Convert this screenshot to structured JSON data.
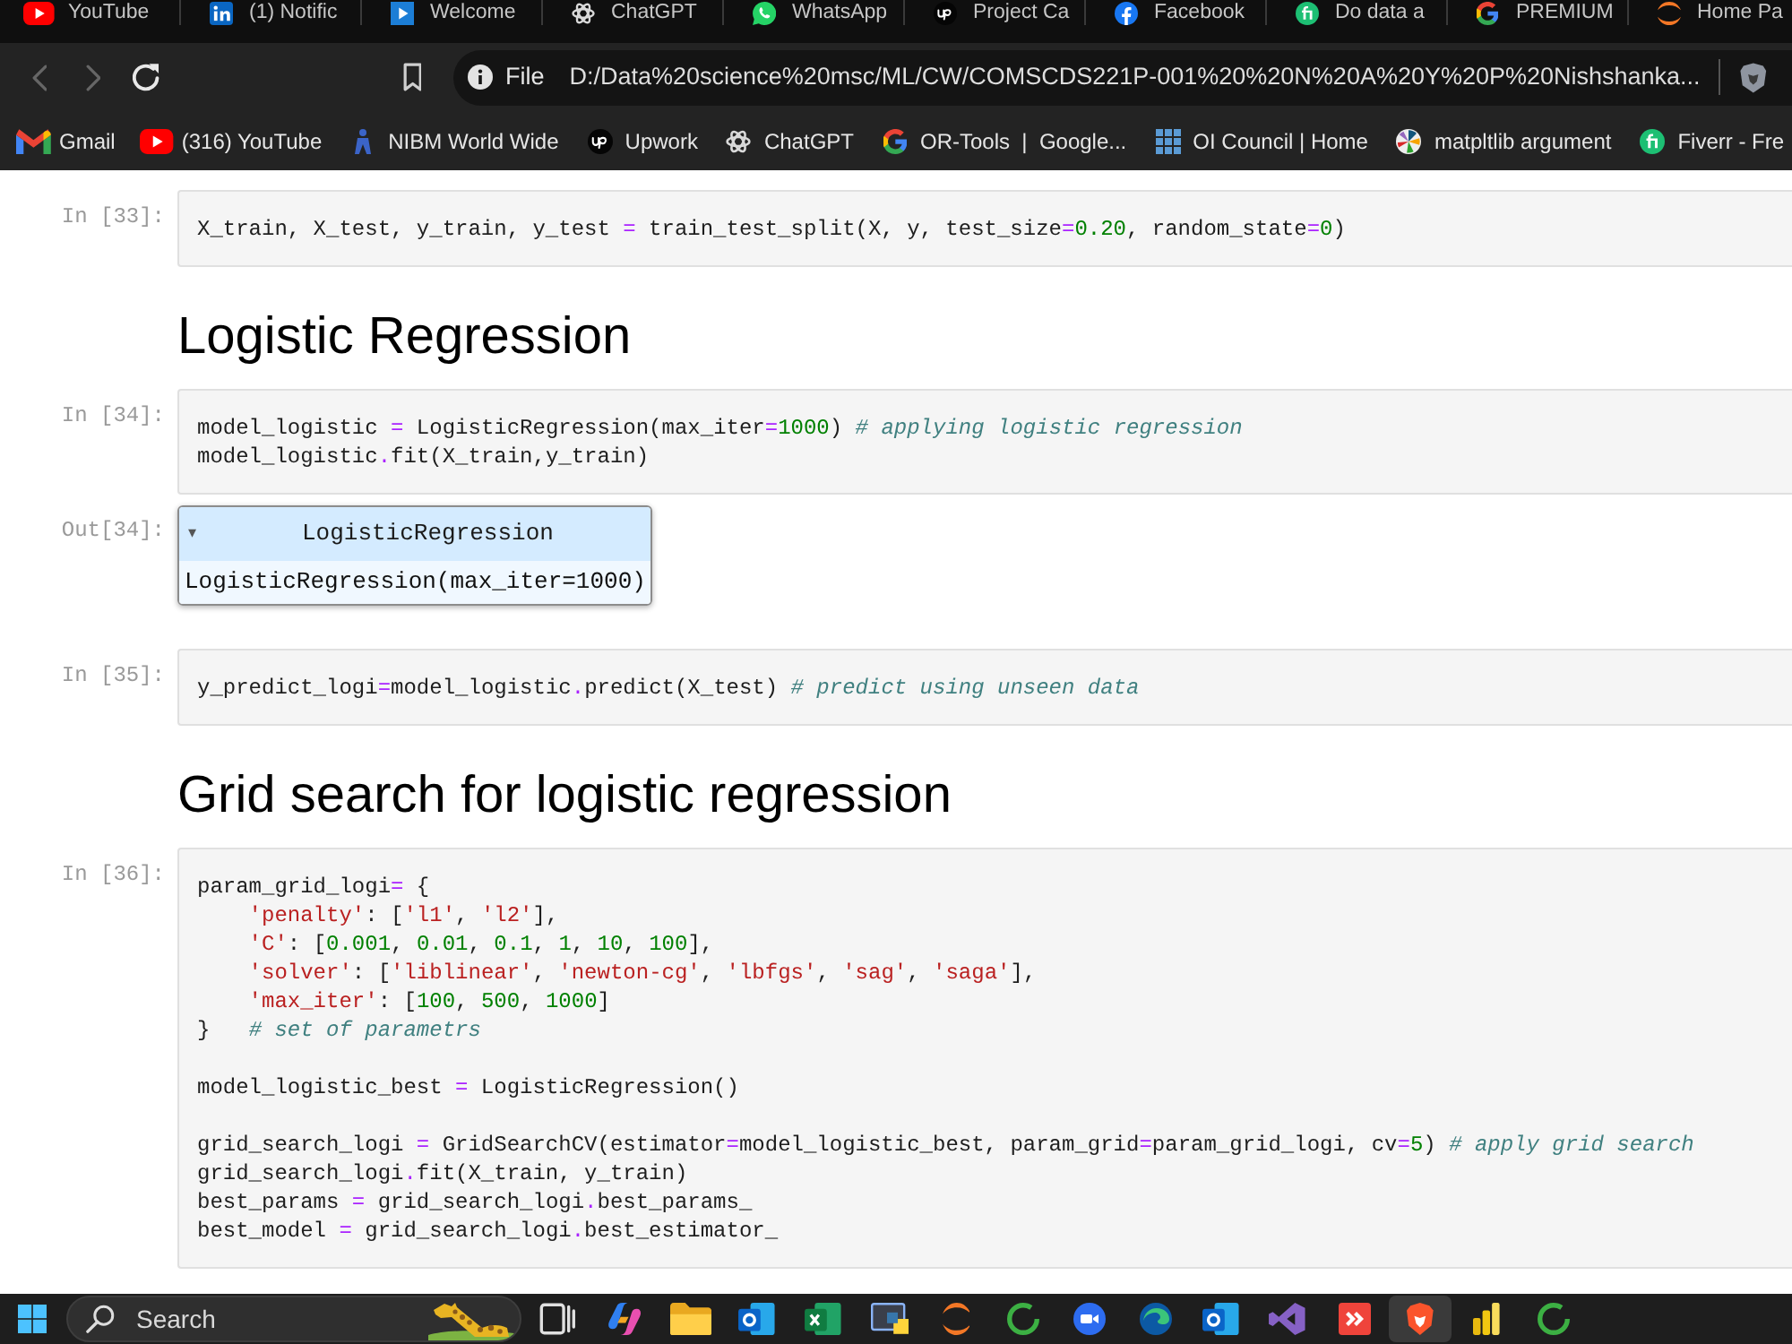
{
  "browser": {
    "tabs": [
      {
        "kind": "play",
        "title": "YouTube"
      },
      {
        "kind": "tile",
        "title": "(1) Notific"
      },
      {
        "kind": "flag",
        "title": "Welcome"
      },
      {
        "kind": "knot",
        "title": "ChatGPT"
      },
      {
        "kind": "chat",
        "title": "WhatsApp"
      },
      {
        "kind": "up",
        "title": "Project Ca"
      },
      {
        "kind": "f",
        "title": "Facebook"
      },
      {
        "kind": "fi",
        "title": "Do data a"
      },
      {
        "kind": "g",
        "title": "PREMIUM"
      },
      {
        "kind": "arc",
        "title": "Home Pa"
      }
    ],
    "toolbar": {
      "back": {
        "disabled": true
      },
      "forward": {
        "disabled": true
      },
      "site_chip": "File",
      "url": "D:/Data%20science%20msc/ML/CW/COMSCDS221P-001%20%20N%20A%20Y%20P%20Nishshanka..."
    },
    "bookmarks": [
      {
        "kind": "mail",
        "label": "Gmail"
      },
      {
        "kind": "play",
        "label": "(316) YouTube"
      },
      {
        "kind": "n",
        "label": "NIBM World Wide"
      },
      {
        "kind": "up",
        "label": "Upwork"
      },
      {
        "kind": "knot",
        "label": "ChatGPT"
      },
      {
        "kind": "g",
        "label": "OR-Tools  |  Google..."
      },
      {
        "kind": "grid",
        "label": "OI Council | Home"
      },
      {
        "kind": "pinwheel",
        "label": "matpltlib argument"
      },
      {
        "kind": "fi",
        "label": "Fiverr - Fre"
      }
    ]
  },
  "notebook": {
    "cells": [
      {
        "kind": "code",
        "prompt": "In [33]:",
        "blocks": [
          [
            [
              {
                "kind": "text",
                "text": "X_train, X_test, y_train, y_test "
              },
              {
                "kind": "op",
                "text": "="
              },
              {
                "kind": "text",
                "text": " train_test_split(X, y, test_size"
              },
              {
                "kind": "op",
                "text": "="
              },
              {
                "kind": "num",
                "text": "0.20"
              },
              {
                "kind": "text",
                "text": ", random_state"
              },
              {
                "kind": "op",
                "text": "="
              },
              {
                "kind": "num",
                "text": "0"
              },
              {
                "kind": "text",
                "text": ")"
              }
            ]
          ]
        ]
      },
      {
        "kind": "heading",
        "text": "Logistic Regression"
      },
      {
        "kind": "code",
        "prompt": "In [34]:",
        "blocks": [
          [
            [
              {
                "kind": "text",
                "text": "model_logistic "
              },
              {
                "kind": "op",
                "text": "="
              },
              {
                "kind": "text",
                "text": " LogisticRegression(max_iter"
              },
              {
                "kind": "op",
                "text": "="
              },
              {
                "kind": "num",
                "text": "1000"
              },
              {
                "kind": "text",
                "text": ") "
              },
              {
                "kind": "comment",
                "text": "# applying logistic regression"
              }
            ],
            [
              {
                "kind": "text",
                "text": "model_logistic"
              },
              {
                "kind": "op",
                "text": "."
              },
              {
                "kind": "text",
                "text": "fit(X_train,y_train)"
              }
            ]
          ]
        ]
      },
      {
        "kind": "output",
        "prompt": "Out[34]:",
        "toggle": "▾",
        "header": "LogisticRegression",
        "body": "LogisticRegression(max_iter=1000)"
      },
      {
        "kind": "code",
        "prompt": "In [35]:",
        "blocks": [
          [
            [
              {
                "kind": "text",
                "text": "y_predict_logi"
              },
              {
                "kind": "op",
                "text": "="
              },
              {
                "kind": "text",
                "text": "model_logistic"
              },
              {
                "kind": "op",
                "text": "."
              },
              {
                "kind": "text",
                "text": "predict(X_test) "
              },
              {
                "kind": "comment",
                "text": "# predict using unseen data"
              }
            ]
          ]
        ]
      },
      {
        "kind": "heading",
        "text": "Grid search for logistic regression"
      },
      {
        "kind": "code",
        "prompt": "In [36]:",
        "blocks": [
          [
            [
              {
                "kind": "text",
                "text": "param_grid_logi"
              },
              {
                "kind": "op",
                "text": "="
              },
              {
                "kind": "text",
                "text": " {"
              }
            ],
            [
              {
                "kind": "str",
                "text": "    'penalty'"
              },
              {
                "kind": "text",
                "text": ": ["
              },
              {
                "kind": "str",
                "text": "'l1'"
              },
              {
                "kind": "text",
                "text": ", "
              },
              {
                "kind": "str",
                "text": "'l2'"
              },
              {
                "kind": "text",
                "text": "],"
              }
            ],
            [
              {
                "kind": "str",
                "text": "    'C'"
              },
              {
                "kind": "text",
                "text": ": ["
              },
              {
                "kind": "num",
                "text": "0.001"
              },
              {
                "kind": "text",
                "text": ", "
              },
              {
                "kind": "num",
                "text": "0.01"
              },
              {
                "kind": "text",
                "text": ", "
              },
              {
                "kind": "num",
                "text": "0.1"
              },
              {
                "kind": "text",
                "text": ", "
              },
              {
                "kind": "num",
                "text": "1"
              },
              {
                "kind": "text",
                "text": ", "
              },
              {
                "kind": "num",
                "text": "10"
              },
              {
                "kind": "text",
                "text": ", "
              },
              {
                "kind": "num",
                "text": "100"
              },
              {
                "kind": "text",
                "text": "],"
              }
            ],
            [
              {
                "kind": "str",
                "text": "    'solver'"
              },
              {
                "kind": "text",
                "text": ": ["
              },
              {
                "kind": "str",
                "text": "'liblinear'"
              },
              {
                "kind": "text",
                "text": ", "
              },
              {
                "kind": "str",
                "text": "'newton-cg'"
              },
              {
                "kind": "text",
                "text": ", "
              },
              {
                "kind": "str",
                "text": "'lbfgs'"
              },
              {
                "kind": "text",
                "text": ", "
              },
              {
                "kind": "str",
                "text": "'sag'"
              },
              {
                "kind": "text",
                "text": ", "
              },
              {
                "kind": "str",
                "text": "'saga'"
              },
              {
                "kind": "text",
                "text": "],"
              }
            ],
            [
              {
                "kind": "str",
                "text": "    'max_iter'"
              },
              {
                "kind": "text",
                "text": ": ["
              },
              {
                "kind": "num",
                "text": "100"
              },
              {
                "kind": "text",
                "text": ", "
              },
              {
                "kind": "num",
                "text": "500"
              },
              {
                "kind": "text",
                "text": ", "
              },
              {
                "kind": "num",
                "text": "1000"
              },
              {
                "kind": "text",
                "text": "]"
              }
            ],
            [
              {
                "kind": "text",
                "text": "}   "
              },
              {
                "kind": "comment",
                "text": "# set of parametrs"
              }
            ]
          ],
          [
            [
              {
                "kind": "text",
                "text": "model_logistic_best "
              },
              {
                "kind": "op",
                "text": "="
              },
              {
                "kind": "text",
                "text": " LogisticRegression()"
              }
            ]
          ],
          [
            [
              {
                "kind": "text",
                "text": "grid_search_logi "
              },
              {
                "kind": "op",
                "text": "="
              },
              {
                "kind": "text",
                "text": " GridSearchCV(estimator"
              },
              {
                "kind": "op",
                "text": "="
              },
              {
                "kind": "text",
                "text": "model_logistic_best, param_grid"
              },
              {
                "kind": "op",
                "text": "="
              },
              {
                "kind": "text",
                "text": "param_grid_logi, cv"
              },
              {
                "kind": "op",
                "text": "="
              },
              {
                "kind": "num",
                "text": "5"
              },
              {
                "kind": "text",
                "text": ") "
              },
              {
                "kind": "comment",
                "text": "# apply grid search"
              }
            ],
            [
              {
                "kind": "text",
                "text": "grid_search_logi"
              },
              {
                "kind": "op",
                "text": "."
              },
              {
                "kind": "text",
                "text": "fit(X_train, y_train)"
              }
            ],
            [
              {
                "kind": "text",
                "text": "best_params "
              },
              {
                "kind": "op",
                "text": "="
              },
              {
                "kind": "text",
                "text": " grid_search_logi"
              },
              {
                "kind": "op",
                "text": "."
              },
              {
                "kind": "text",
                "text": "best_params_"
              }
            ],
            [
              {
                "kind": "text",
                "text": "best_model "
              },
              {
                "kind": "op",
                "text": "="
              },
              {
                "kind": "text",
                "text": " grid_search_logi"
              },
              {
                "kind": "op",
                "text": "."
              },
              {
                "kind": "text",
                "text": "best_estimator_"
              }
            ]
          ]
        ]
      }
    ]
  },
  "taskbar": {
    "search": {
      "label": "Search"
    },
    "apps": [
      {
        "kind": "taskview",
        "selected": false
      },
      {
        "kind": "copilot",
        "selected": false
      },
      {
        "kind": "folder",
        "selected": false
      },
      {
        "kind": "outlook",
        "selected": false
      },
      {
        "kind": "excel",
        "selected": false
      },
      {
        "kind": "ide",
        "selected": false
      },
      {
        "kind": "arcs",
        "selected": false
      },
      {
        "kind": "ring",
        "selected": false
      },
      {
        "kind": "zoom",
        "selected": false
      },
      {
        "kind": "edge",
        "selected": false
      },
      {
        "kind": "outlook",
        "selected": false
      },
      {
        "kind": "studio",
        "selected": false
      },
      {
        "kind": "anydesk",
        "selected": false
      },
      {
        "kind": "brave",
        "selected": true
      },
      {
        "kind": "bars",
        "selected": false
      },
      {
        "kind": "ring",
        "selected": false
      }
    ]
  }
}
